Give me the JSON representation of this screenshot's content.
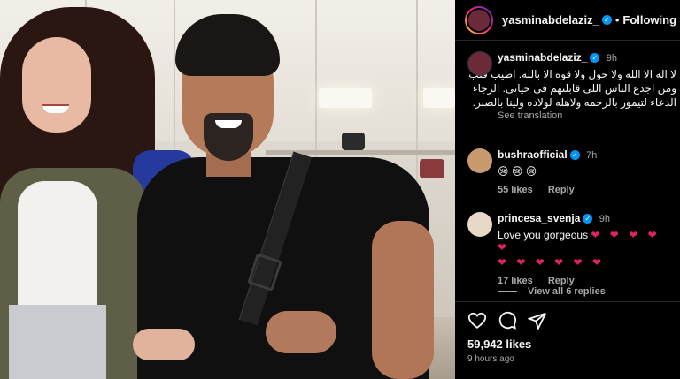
{
  "post": {
    "author": "yasminabdelaziz_",
    "follow_status": "Following",
    "separator": "•"
  },
  "caption": {
    "user": "yasminabdelaziz_",
    "time": "9h",
    "text": "لا اله الا الله ولا حول ولا قوه الا بالله. اطيب قلب ومن اجدع الناس اللى قابلتهم فى حياتى. الرجاء الدعاء لتيمور بالرحمه ولاهله لولاده ولينا بالصبر.",
    "see_translation": "See translation"
  },
  "comments": [
    {
      "user": "bushraofficial",
      "time": "7h",
      "text": "😢 😢 😢",
      "likes": "55 likes",
      "reply": "Reply"
    },
    {
      "user": "princesa_svenja",
      "time": "9h",
      "text": "Love you gorgeous",
      "hearts": "❤ ❤ ❤ ❤ ❤",
      "hearts2": "❤ ❤ ❤ ❤ ❤ ❤",
      "likes": "17 likes",
      "reply": "Reply"
    }
  ],
  "view_replies": "View all 6 replies",
  "actions": {
    "like_icon": "heart-icon",
    "comment_icon": "comment-icon",
    "share_icon": "share-icon"
  },
  "stats": {
    "likes": "59,942 likes",
    "posted": "9 hours ago"
  },
  "colors": {
    "background": "#000000",
    "verified": "#0095f6",
    "muted": "#a8a8a8",
    "heart": "#e0245e"
  }
}
